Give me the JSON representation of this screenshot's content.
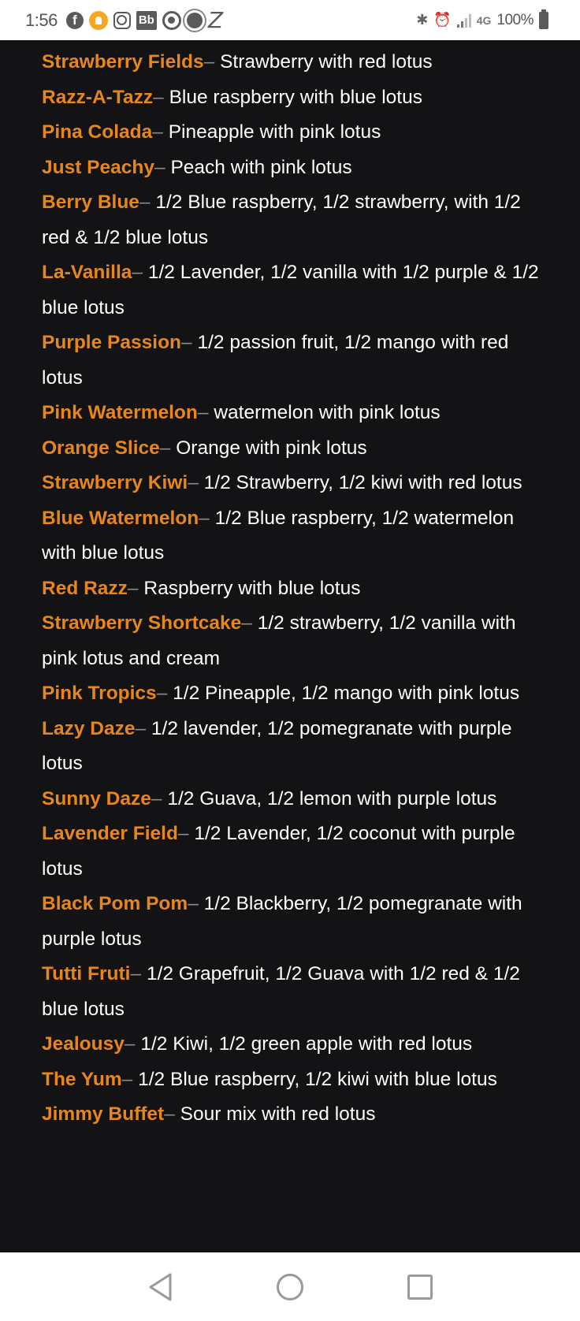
{
  "status_bar": {
    "time": "1:56",
    "left_icons": [
      "facebook-icon",
      "notification-bell-icon",
      "instagram-icon",
      "blackboard-icon",
      "target-icon",
      "sun-icon",
      "z-app-icon"
    ],
    "right_icons": [
      "bluetooth-icon",
      "alarm-icon",
      "signal-icon",
      "4g-lte-icon",
      "battery-icon"
    ],
    "network": "4G",
    "battery": "100%",
    "bell_color": "#f5a623"
  },
  "content": {
    "accent_color": "#e6861c",
    "background_color": "#131316",
    "separator": "–",
    "entries": [
      {
        "name": "Strawberry Fields",
        "description": " Strawberry with red lotus"
      },
      {
        "name": "Razz-A-Tazz",
        "description": "Blue raspberry with blue lotus"
      },
      {
        "name": "Pina Colada",
        "description": "Pineapple with pink lotus"
      },
      {
        "name": "Just Peachy",
        "description": "Peach with pink lotus"
      },
      {
        "name": "Berry Blue",
        "description": "1/2 Blue raspberry, 1/2 strawberry, with 1/2 red & 1/2 blue lotus"
      },
      {
        "name": "La-Vanilla",
        "description": "1/2 Lavender, 1/2 vanilla with 1/2 purple & 1/2 blue lotus"
      },
      {
        "name": "Purple Passion",
        "description": "1/2 passion fruit, 1/2 mango with red lotus"
      },
      {
        "name": "Pink Watermelon",
        "description": "watermelon with pink lotus"
      },
      {
        "name": "Orange Slice",
        "description": "Orange with pink lotus"
      },
      {
        "name": "Strawberry Kiwi",
        "description": "1/2 Strawberry, 1/2 kiwi with red lotus"
      },
      {
        "name": "Blue Watermelon",
        "description": "1/2 Blue raspberry, 1/2 watermelon with blue lotus"
      },
      {
        "name": "Red Razz",
        "description": "Raspberry with blue lotus"
      },
      {
        "name": "Strawberry Shortcake",
        "description": "1/2 strawberry, 1/2 vanilla with pink lotus and cream"
      },
      {
        "name": "Pink Tropics",
        "description": "1/2 Pineapple, 1/2 mango with pink lotus"
      },
      {
        "name": "Lazy Daze",
        "description": "1/2 lavender, 1/2 pomegranate with purple lotus"
      },
      {
        "name": "Sunny Daze",
        "description": "1/2 Guava, 1/2 lemon with purple lotus"
      },
      {
        "name": "Lavender Field",
        "description": "1/2 Lavender, 1/2 coconut with purple lotus"
      },
      {
        "name": "Black Pom Pom",
        "description": "1/2 Blackberry, 1/2 pomegranate with purple lotus"
      },
      {
        "name": "Tutti Fruti",
        "description": "1/2 Grapefruit, 1/2 Guava with 1/2 red & 1/2 blue lotus"
      },
      {
        "name": "Jealousy",
        "description": "1/2 Kiwi, 1/2 green apple with red lotus"
      },
      {
        "name": "The Yum",
        "description": "1/2 Blue raspberry, 1/2 kiwi with blue lotus"
      },
      {
        "name": "Jimmy Buffet",
        "description": "Sour mix with red lotus"
      }
    ]
  },
  "nav_bar": {
    "buttons": [
      "back",
      "home",
      "recent-apps"
    ]
  }
}
